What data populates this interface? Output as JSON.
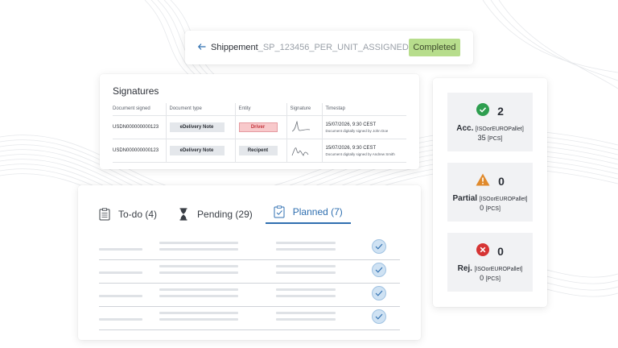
{
  "shipment": {
    "back_icon": "arrow-left-icon",
    "label": "Shippement",
    "id": "_SP_123456_PER_UNIT_ASSIGNED",
    "status": "Completed",
    "status_color": "#b7dd8c"
  },
  "signatures": {
    "title": "Signatures",
    "columns": [
      "Document signed",
      "Document type",
      "Entity",
      "Signature",
      "Timestap"
    ],
    "rows": [
      {
        "document": "USDN000000000123",
        "type": "eDelivery Note",
        "entity": "Driver",
        "entity_color": "#c3343c",
        "timestamp": "15/07/2026, 9:30 CEST",
        "signed_by": "Document digitally signed by John Doe"
      },
      {
        "document": "USDN000000000123",
        "type": "eDelivery Note",
        "entity": "Recipent",
        "entity_color": "#2b2f36",
        "timestamp": "15/07/2026, 9:30 CEST",
        "signed_by": "Document digitally signed by Andrew Smith"
      }
    ]
  },
  "tasks": {
    "tabs": [
      {
        "label": "To-do (4)",
        "icon": "clipboard-list-icon"
      },
      {
        "label": "Pending (29)",
        "icon": "hourglass-icon"
      },
      {
        "label": "Planned (7)",
        "icon": "clipboard-check-icon"
      }
    ],
    "active_tab": "Planned (7)",
    "accent_color": "#2f6fb0"
  },
  "summary": [
    {
      "icon": "check-circle-icon",
      "icon_color": "#2e9e4f",
      "count": "2",
      "label": "Acc.",
      "pallet": "[ISOorEUROPallet]",
      "qty": "35",
      "unit": "[PCS]"
    },
    {
      "icon": "warning-triangle-icon",
      "icon_color": "#e08a2c",
      "count": "0",
      "label": "Partial",
      "pallet": "[ISOorEUROPallet]",
      "qty": "0",
      "unit": "[PCS]"
    },
    {
      "icon": "x-circle-icon",
      "icon_color": "#d63434",
      "count": "0",
      "label": "Rej.",
      "pallet": "[ISOorEUROPallet]",
      "qty": "0",
      "unit": "[PCS]"
    }
  ]
}
